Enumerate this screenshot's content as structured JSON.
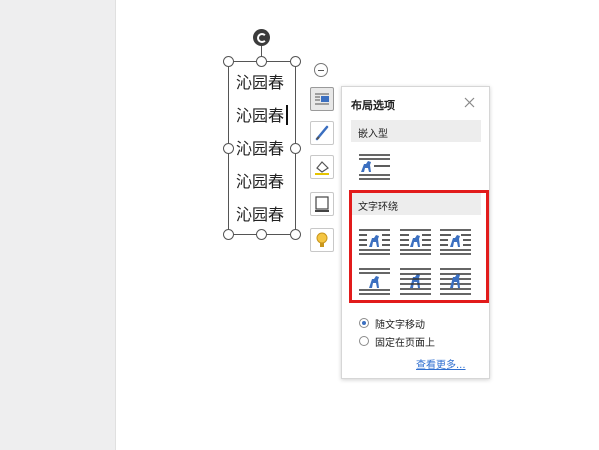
{
  "document": {
    "lines": [
      "沁园春",
      "沁园春",
      "沁园春",
      "沁园春",
      "沁园春"
    ]
  },
  "toolbar": {
    "items": [
      {
        "icon": "layout-options-icon",
        "active": true
      },
      {
        "icon": "brush-icon",
        "active": false
      },
      {
        "icon": "fill-icon",
        "active": false
      },
      {
        "icon": "border-icon",
        "active": false
      },
      {
        "icon": "lightbulb-icon",
        "active": false
      }
    ]
  },
  "layout_panel": {
    "title": "布局选项",
    "inline_section": "嵌入型",
    "wrap_section": "文字环绕",
    "options": {
      "move_with_text": "随文字移动",
      "fixed_on_page": "固定在页面上",
      "selected": "move_with_text"
    },
    "more_link": "查看更多..."
  },
  "colors": {
    "highlight": "#e21b1b",
    "accent": "#3b6fc0",
    "link": "#2f6fd0"
  }
}
